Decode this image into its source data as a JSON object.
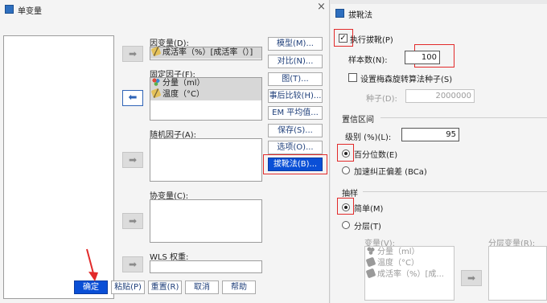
{
  "left_dialog": {
    "title": "单变量",
    "close": "×",
    "dependent": {
      "label": "因变量(D):",
      "item": "成活率（%）[成活率（）]"
    },
    "fixed": {
      "label": "固定因子(F):",
      "items": [
        "分量（ml）",
        "温度（°C）"
      ]
    },
    "random": {
      "label": "随机因子(A):"
    },
    "covariate": {
      "label": "协变量(C):"
    },
    "wls": {
      "label": "WLS 权重:"
    },
    "arrows": {
      "right": "➡",
      "left": "⬅"
    },
    "right_buttons": [
      "模型(M)...",
      "对比(N)...",
      "图(T)...",
      "事后比较(H)...",
      "EM 平均值...",
      "保存(S)...",
      "选项(O)...",
      "拔靴法(B)..."
    ],
    "bottom_buttons": [
      "确定",
      "粘贴(P)",
      "重置(R)",
      "取消",
      "帮助"
    ]
  },
  "right_dialog": {
    "title": "拔靴法",
    "perform": {
      "label": "执行拔靴(P)",
      "checked": true
    },
    "samples": {
      "label": "样本数(N):",
      "value": "100"
    },
    "mersenne": {
      "label": "设置梅森旋转算法种子(S)",
      "checked": false
    },
    "seed": {
      "label": "种子(D):",
      "value": "2000000"
    },
    "ci": {
      "heading": "置信区间",
      "level_label": "级别 (%)(L):",
      "level_value": "95",
      "percentile": "百分位数(E)",
      "bca": "加速纠正偏差 (BCa)"
    },
    "sampling": {
      "heading": "抽样",
      "simple": "简单(M)",
      "stratified": "分层(T)",
      "variables_label": "变量(V):",
      "strata_label": "分层变量(R):",
      "variables": [
        "分量（ml）",
        "温度（°C）",
        "成活率（%）[成..."
      ]
    }
  },
  "colors": {
    "accent": "#0a4fd6",
    "highlight": "#e22a2a"
  }
}
